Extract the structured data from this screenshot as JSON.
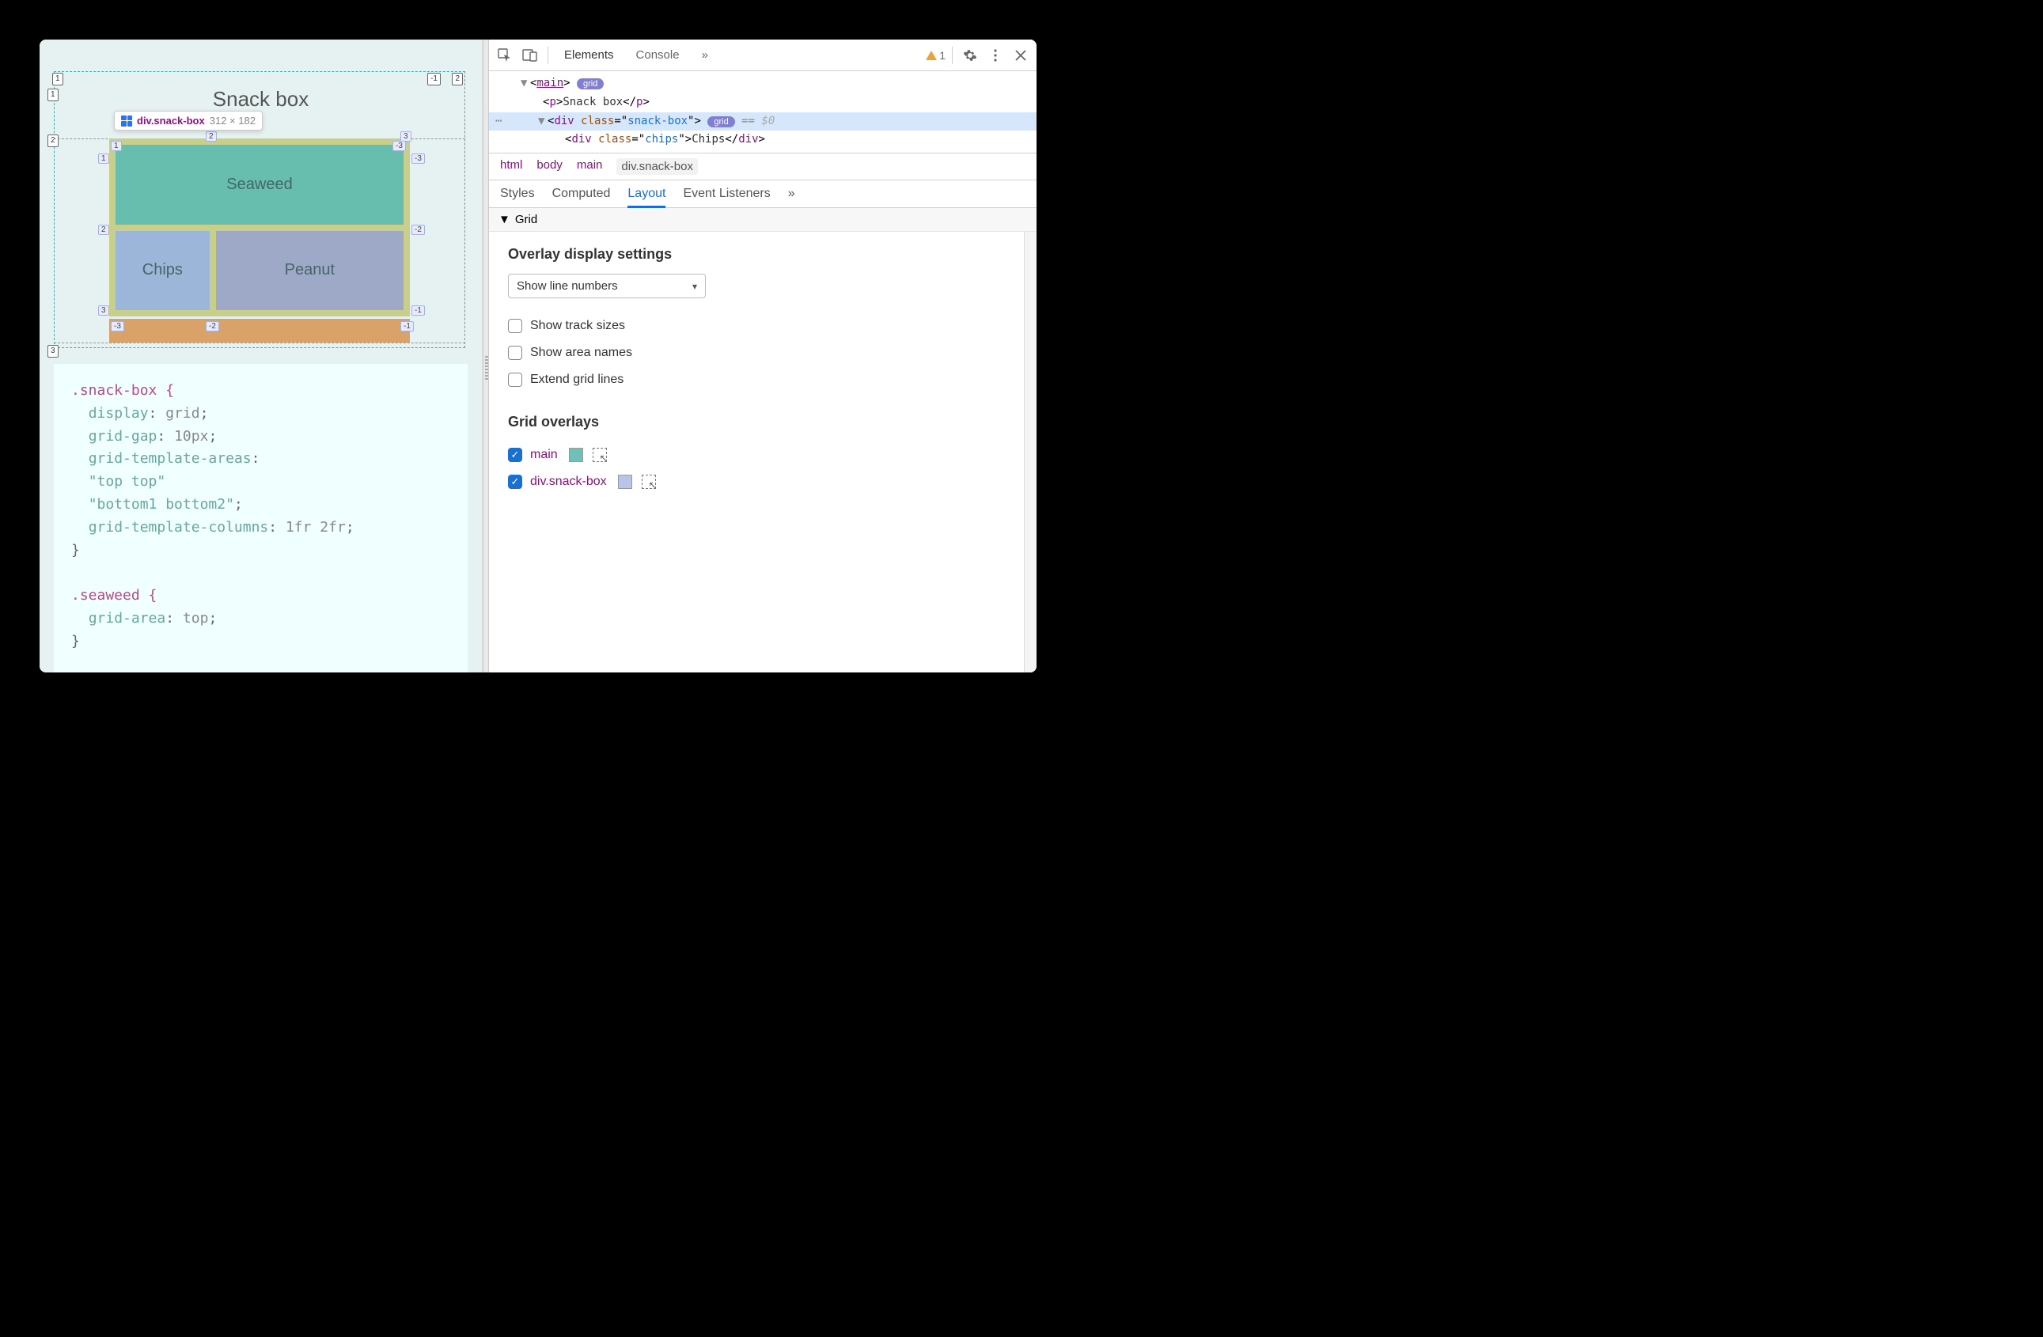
{
  "page": {
    "heading": "Snack box",
    "cells": {
      "seaweed": "Seaweed",
      "chips": "Chips",
      "peanut": "Peanut"
    },
    "tooltip": {
      "selector": "div.snack-box",
      "dims": "312 × 182"
    },
    "axis_labels": {
      "outer_cols_top": [
        "1",
        "-1",
        "2"
      ],
      "outer_rows_left": [
        "1",
        "2",
        "3"
      ],
      "inner_top": [
        "1",
        "2",
        "3"
      ],
      "inner_top_neg": [
        "-3"
      ],
      "inner_left": [
        "1",
        "2",
        "3"
      ],
      "inner_right": [
        "-3",
        "-2",
        "-1"
      ],
      "inner_bottom": [
        "-3",
        "-2",
        "-1"
      ]
    }
  },
  "code": {
    "block1_selector": ".snack-box {",
    "l1_prop": "display",
    "l1_val": "grid",
    "l2_prop": "grid-gap",
    "l2_val": "10px",
    "l3_prop": "grid-template-areas",
    "l3_val1": "\"top top\"",
    "l3_val2": "\"bottom1 bottom2\"",
    "l4_prop": "grid-template-columns",
    "l4_val": "1fr 2fr",
    "close1": "}",
    "block2_selector": ".seaweed {",
    "l5_prop": "grid-area",
    "l5_val": "top",
    "close2": "}"
  },
  "toolbar": {
    "tabs": [
      "Elements",
      "Console"
    ],
    "more": "»",
    "warn_count": "1"
  },
  "dom": {
    "r1_tag": "main",
    "r1_badge": "grid",
    "r2_tag": "p",
    "r2_text": "Snack box",
    "r3_tag": "div",
    "r3_attr": "class",
    "r3_val": "snack-box",
    "r3_badge": "grid",
    "r3_eq": " == ",
    "r3_ref": "$0",
    "r4_tag": "div",
    "r4_attr": "class",
    "r4_val": "chips",
    "r4_text": "Chips"
  },
  "crumbs": [
    "html",
    "body",
    "main",
    "div.snack-box"
  ],
  "subtabs": [
    "Styles",
    "Computed",
    "Layout",
    "Event Listeners"
  ],
  "subtabs_more": "»",
  "grid_section": {
    "header": "Grid",
    "overlay_settings_title": "Overlay display settings",
    "select_value": "Show line numbers",
    "checks": [
      "Show track sizes",
      "Show area names",
      "Extend grid lines"
    ],
    "overlays_title": "Grid overlays",
    "overlays": [
      {
        "name": "main",
        "swatch": "teal"
      },
      {
        "name": "div.snack-box",
        "swatch": "lav"
      }
    ]
  }
}
